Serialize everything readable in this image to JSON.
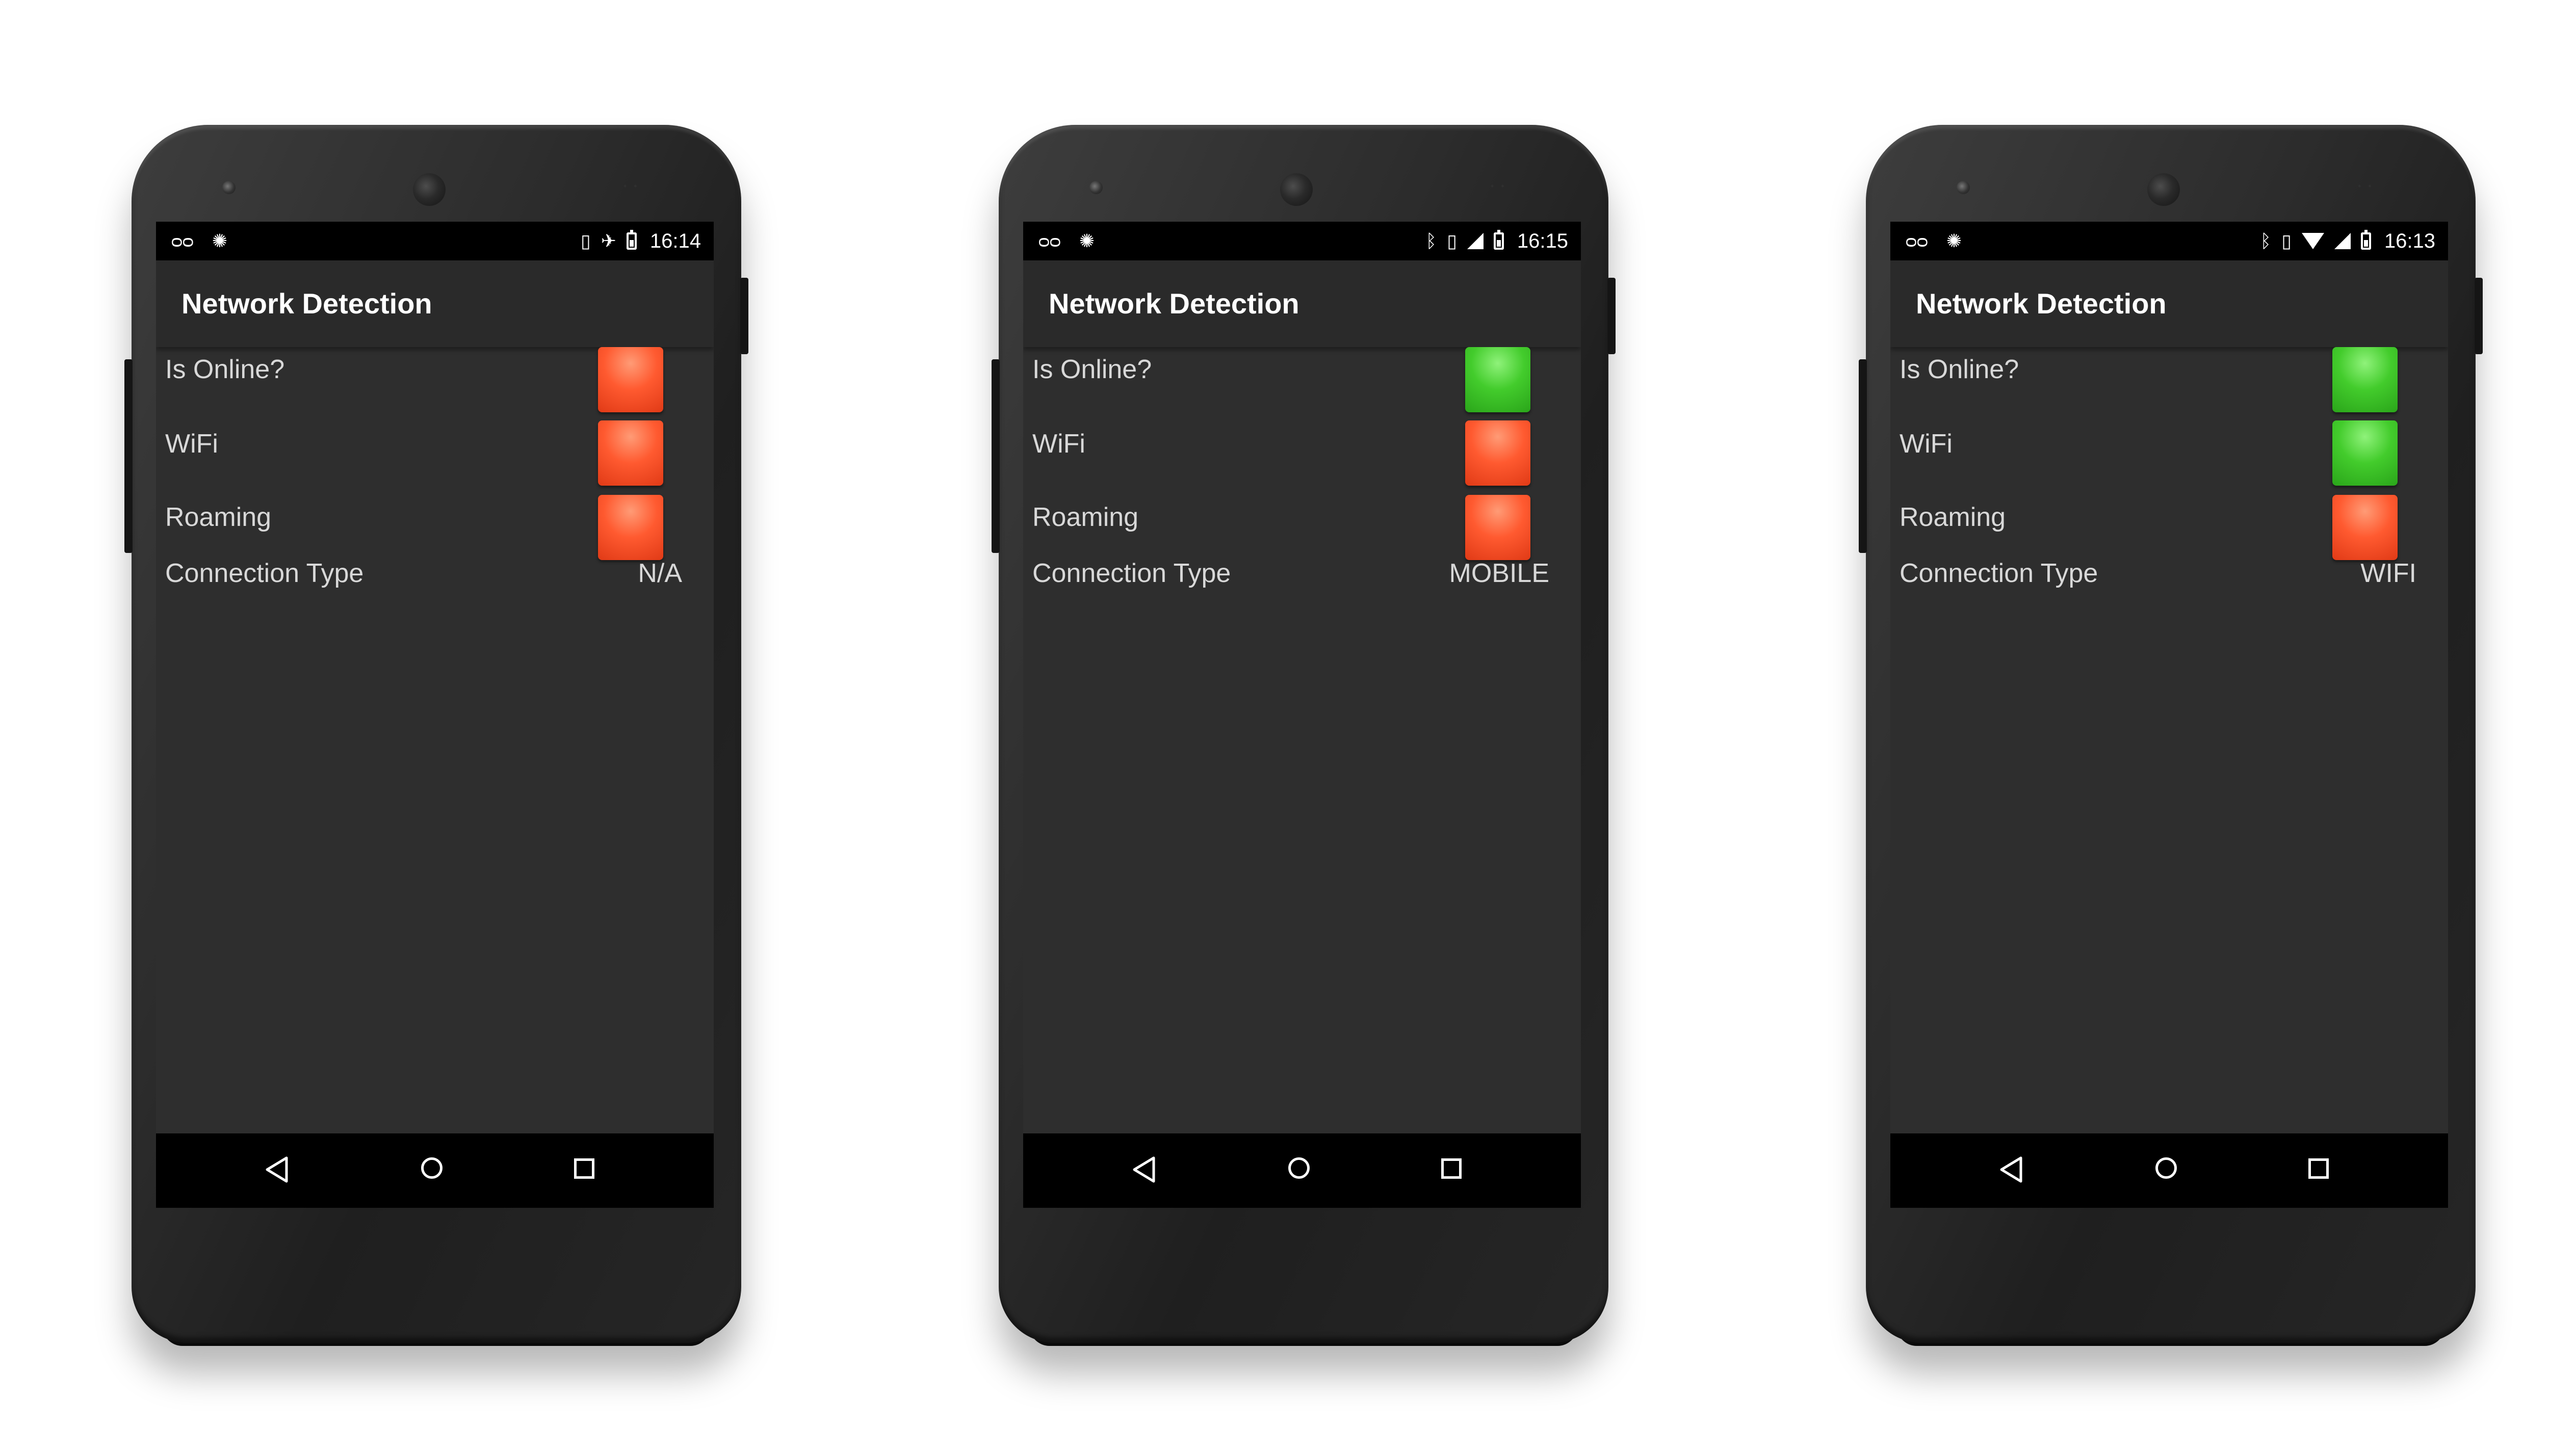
{
  "app_title": "Network Detection",
  "labels": {
    "online": "Is Online?",
    "wifi": "WiFi",
    "roaming": "Roaming",
    "connection_type": "Connection Type"
  },
  "colors": {
    "indicator_on": "#43cc2c",
    "indicator_off": "#ff5a30",
    "screen_background": "#2e2e2e",
    "text": "#d8d8d8"
  },
  "status_icons_left": [
    "voicemail-icon",
    "android-debug-icon"
  ],
  "phones": [
    {
      "clock": "16:14",
      "status_icons_right": [
        "vibrate-icon",
        "airplane-mode-icon",
        "battery-charging-icon"
      ],
      "online": false,
      "wifi": false,
      "roaming": false,
      "connection_type": "N/A"
    },
    {
      "clock": "16:15",
      "status_icons_right": [
        "bluetooth-icon",
        "vibrate-icon",
        "cell-signal-icon",
        "battery-charging-icon"
      ],
      "online": true,
      "wifi": false,
      "roaming": false,
      "connection_type": "MOBILE"
    },
    {
      "clock": "16:13",
      "status_icons_right": [
        "bluetooth-icon",
        "vibrate-icon",
        "wifi-signal-icon",
        "cell-signal-icon",
        "battery-charging-icon"
      ],
      "online": true,
      "wifi": true,
      "roaming": false,
      "connection_type": "WIFI"
    }
  ]
}
